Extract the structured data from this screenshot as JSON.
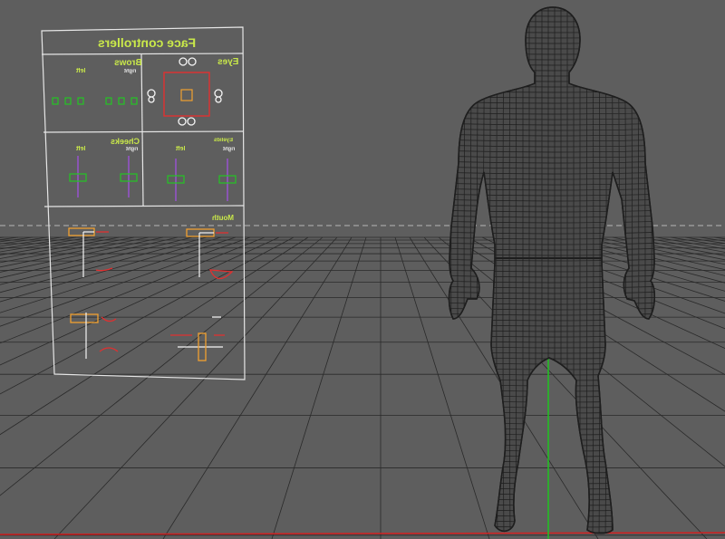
{
  "viewport": {
    "background": "#5e5e5e",
    "colors": {
      "grid": "#2a2a2a",
      "horizon": "#b5b5b5",
      "mesh_fill": "#4a4a4a",
      "mesh_wire": "#1e1e1e",
      "panel_border": "#e6e6e6",
      "panel_text": "#c9e84a",
      "ctrl_green": "#24c524",
      "ctrl_orange": "#f0a030",
      "ctrl_red": "#e03030",
      "ctrl_purple": "#a050e0",
      "axis_green": "#1fc41f",
      "axis_red": "#d02020"
    }
  },
  "panel": {
    "title": "Face controllers",
    "eyes": {
      "label": "Eyes"
    },
    "brows": {
      "label": "Brows",
      "right": "right",
      "left": "left"
    },
    "eyelids": {
      "label": "Eyelids",
      "right": "right",
      "left": "left"
    },
    "cheeks": {
      "label": "Cheeks",
      "right": "right",
      "left": "left"
    },
    "mouth": {
      "label": "Mouth"
    }
  }
}
